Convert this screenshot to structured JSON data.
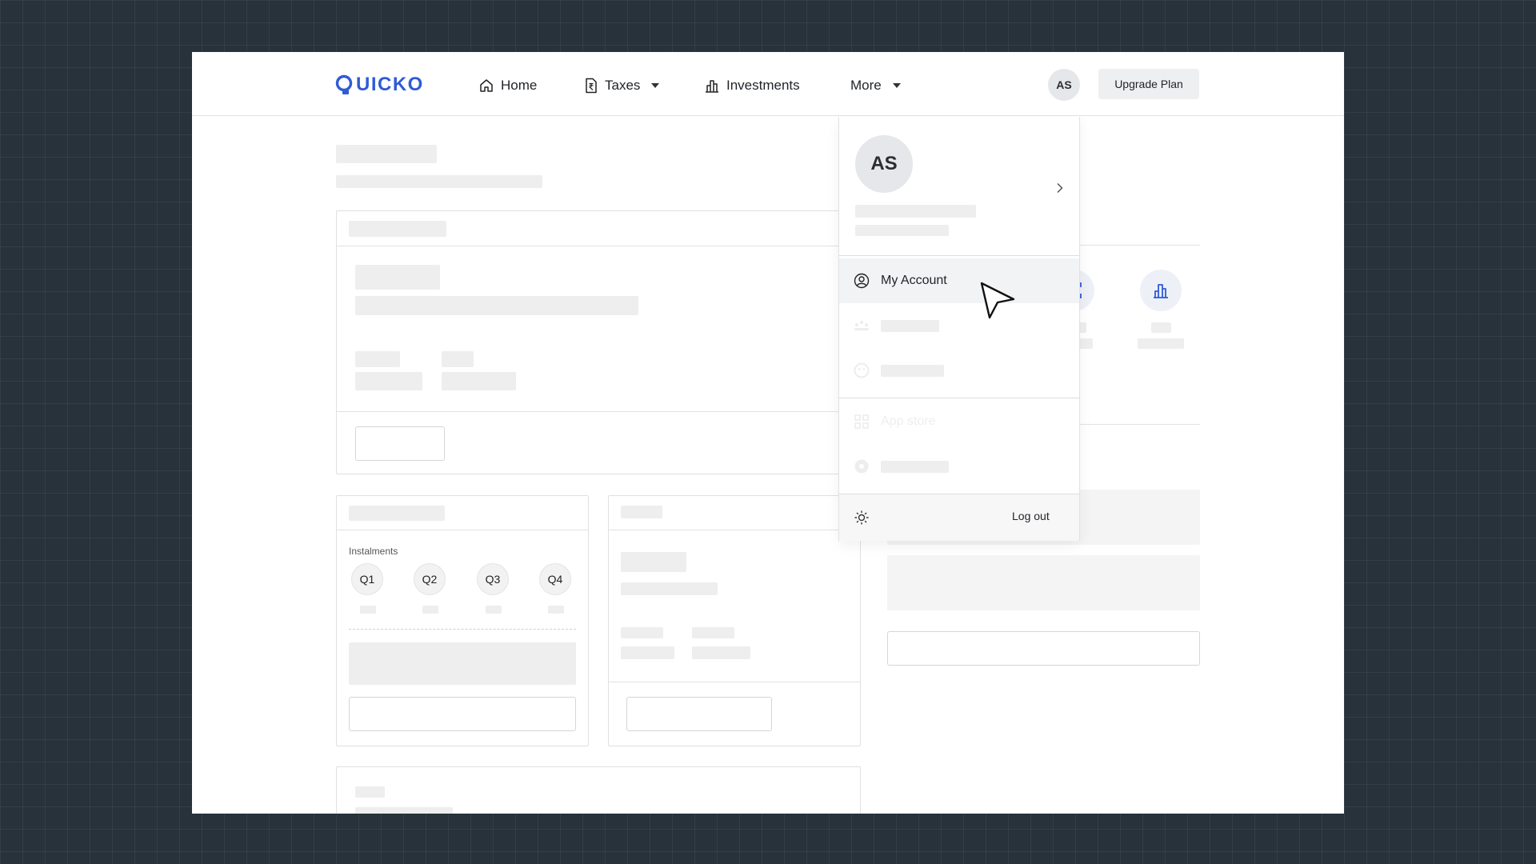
{
  "app": {
    "logo_text": "UICKO",
    "brand_color": "#2f5bd6"
  },
  "nav": {
    "home_label": "Home",
    "taxes_label": "Taxes",
    "investments_label": "Investments",
    "more_label": "More"
  },
  "header": {
    "avatar_initials": "AS",
    "upgrade_label": "Upgrade Plan"
  },
  "filing_card": {
    "instalments_label": "Instalments",
    "quarters": [
      "Q1",
      "Q2",
      "Q3",
      "Q4"
    ]
  },
  "dropdown": {
    "avatar_initials": "AS",
    "items": [
      {
        "label": "My Account",
        "icon": "user-circle-icon",
        "state": "hovered"
      },
      {
        "label": "",
        "icon": "people-group-icon",
        "state": "loading"
      },
      {
        "label": "",
        "icon": "face-icon",
        "state": "loading"
      },
      {
        "label": "App store",
        "icon": "app-grid-icon",
        "state": "faded"
      },
      {
        "label": "",
        "icon": "lifebuoy-icon",
        "state": "loading"
      }
    ],
    "logout_label": "Log out",
    "theme_icon": "sun-icon"
  }
}
